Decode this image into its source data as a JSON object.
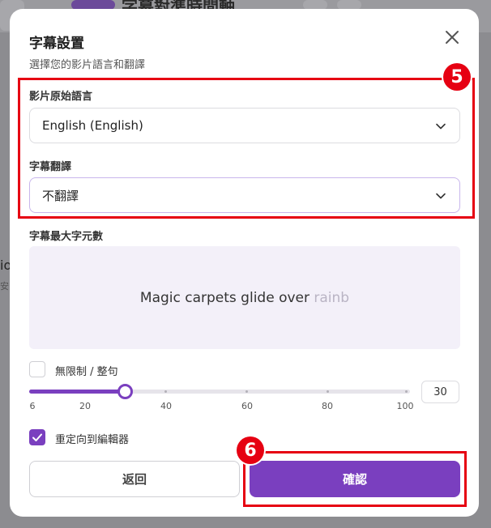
{
  "background": {
    "title": "字幕對準時間軸",
    "left_text": "io",
    "left_sub": "安"
  },
  "modal": {
    "title": "字幕設置",
    "subtitle": "選擇您的影片語言和翻譯",
    "close_icon": "close-icon"
  },
  "source_language": {
    "label": "影片原始語言",
    "value": "English (English)"
  },
  "translation": {
    "label": "字幕翻譯",
    "value": "不翻譯"
  },
  "max_chars": {
    "label": "字幕最大字元數",
    "preview_text": "Magic carpets glide over ",
    "preview_overflow": "rainb"
  },
  "unlimited": {
    "label": "無限制 / 整句",
    "checked": false
  },
  "slider": {
    "value": 30,
    "min": 6,
    "max": 100,
    "ticks": [
      "6",
      "20",
      "40",
      "60",
      "80",
      "100"
    ],
    "input_value": "30"
  },
  "redirect": {
    "label": "重定向到編輯器",
    "checked": true
  },
  "buttons": {
    "back": "返回",
    "confirm": "確認"
  },
  "annotations": {
    "step_a": "5",
    "step_b": "6"
  },
  "colors": {
    "accent": "#7a3fbf",
    "annotation": "#e60012"
  }
}
